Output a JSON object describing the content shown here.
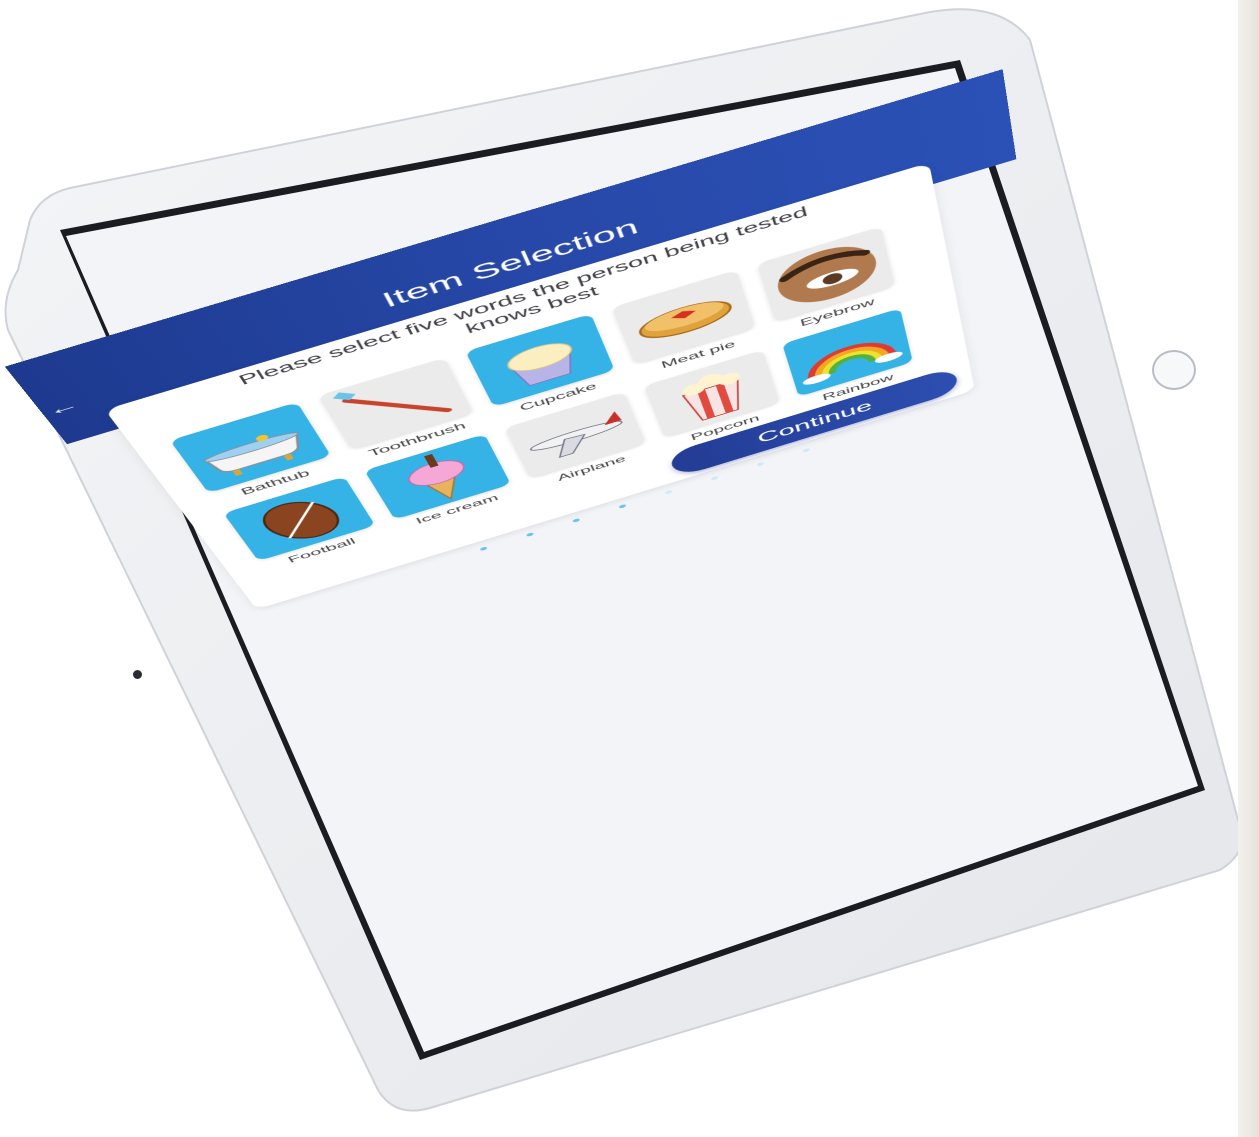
{
  "header": {
    "title": "Item Selection",
    "back_icon": "back-arrow-icon"
  },
  "instructions": "Please select five words the person being tested knows best",
  "items": [
    {
      "label": "Bathtub",
      "icon": "bathtub-icon",
      "selected": true
    },
    {
      "label": "Toothbrush",
      "icon": "toothbrush-icon",
      "selected": false
    },
    {
      "label": "Cupcake",
      "icon": "cupcake-icon",
      "selected": true
    },
    {
      "label": "Meat pie",
      "icon": "meat-pie-icon",
      "selected": false
    },
    {
      "label": "Eyebrow",
      "icon": "eyebrow-icon",
      "selected": false
    },
    {
      "label": "Football",
      "icon": "football-icon",
      "selected": true
    },
    {
      "label": "Ice cream",
      "icon": "ice-cream-icon",
      "selected": true
    },
    {
      "label": "Airplane",
      "icon": "airplane-icon",
      "selected": false
    },
    {
      "label": "Popcorn",
      "icon": "popcorn-icon",
      "selected": false
    },
    {
      "label": "Rainbow",
      "icon": "rainbow-icon",
      "selected": true
    }
  ],
  "continue_label": "Continue",
  "pagination": {
    "count": 8,
    "active_index": 3
  },
  "colors": {
    "header": "#2748a8",
    "selected_tile": "#36b3e6",
    "unselected_tile": "#ebebeb",
    "button": "#2a47a8"
  }
}
